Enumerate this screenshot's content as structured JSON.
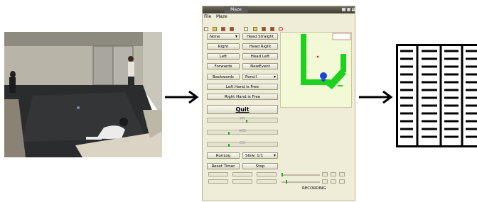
{
  "window": {
    "title": "Maze",
    "menu": [
      "File",
      "Maze"
    ],
    "buttons": {
      "none": "None",
      "head_straight": "Head Straight",
      "right": "Right",
      "head_right": "Head Right",
      "left": "Left",
      "head_left": "Head Left",
      "forwards": "Forwards",
      "new_event": "NewEvent",
      "backwards": "Backwards",
      "pencil": "Pencil",
      "left_hand": "Left Hand is Free",
      "right_hand": "Right Hand is Free",
      "quit": "Quit",
      "run_log": "RunLog",
      "speed": "Slow: 1/1",
      "reset_timer": "Reset Timer",
      "stop": "Stop"
    },
    "sliders": [
      "PTI",
      "AGE",
      "EXI"
    ],
    "slider_levels": [
      0.55,
      0.3,
      0.3
    ],
    "status": "RECORDING"
  },
  "colors": {
    "maze_wall": "#1fd11f",
    "agent": "#1b45d6",
    "target": "#e02020",
    "map_bg": "#f3f8d6"
  }
}
